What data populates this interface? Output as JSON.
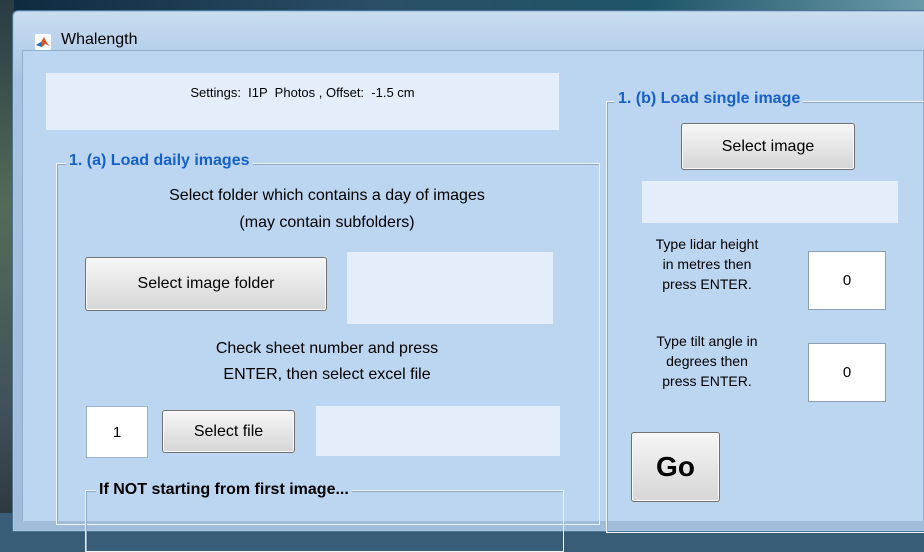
{
  "window": {
    "title": "Whalength"
  },
  "settings": {
    "text": "Settings:  I1P  Photos , Offset:  -1.5 cm"
  },
  "panel_a": {
    "legend": "1. (a) Load daily images",
    "instruction_line1": "Select folder which contains a day of images",
    "instruction_line2": "(may contain subfolders)",
    "select_folder_label": "Select image folder",
    "sheet_instruction_line1": "Check sheet number and press",
    "sheet_instruction_line2": "ENTER, then select excel file",
    "sheet_number_value": "1",
    "select_file_label": "Select file",
    "sub_panel_legend": "If NOT starting from first image..."
  },
  "panel_b": {
    "legend": "1. (b) Load single image",
    "select_image_label": "Select image",
    "lidar_label_line1": "Type lidar height",
    "lidar_label_line2": "in metres then",
    "lidar_label_line3": "press ENTER.",
    "lidar_value": "0",
    "tilt_label_line1": "Type tilt angle in",
    "tilt_label_line2": "degrees then",
    "tilt_label_line3": "press ENTER.",
    "tilt_value": "0",
    "go_label": "Go"
  },
  "colors": {
    "legend_blue": "#1660c9",
    "panel_bg": "#bcd6f1",
    "field_bg": "#e3eefa"
  },
  "icons": {
    "app_icon": "matlab-logo-icon"
  }
}
